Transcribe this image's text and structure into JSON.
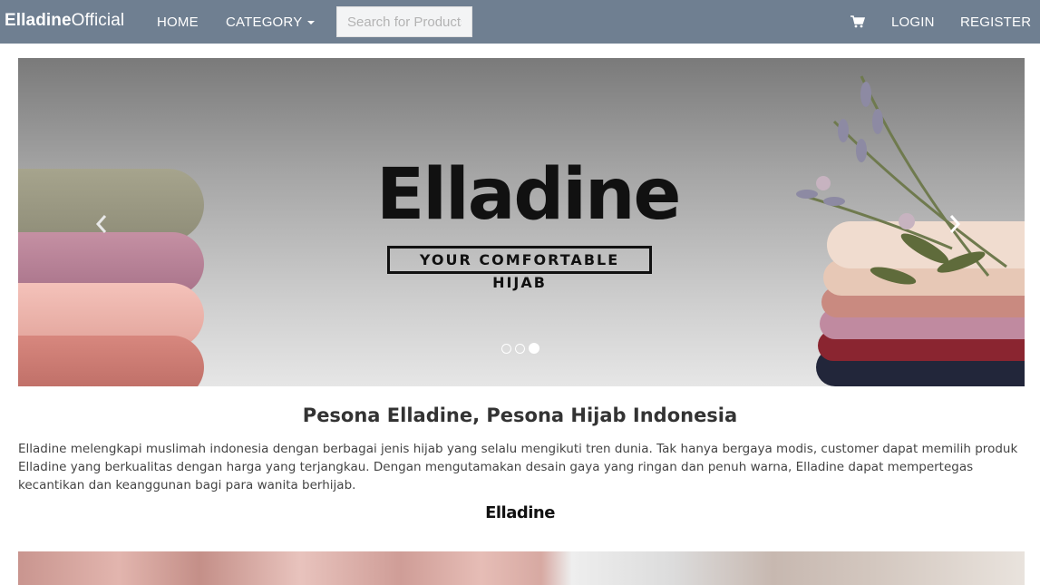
{
  "brand": {
    "bold": "Elladine",
    "regular": "Official"
  },
  "nav": {
    "home": "HOME",
    "category": "CATEGORY",
    "search_placeholder": "Search for Products",
    "cart_icon": "shopping-cart-icon",
    "login": "LOGIN",
    "register": "REGISTER"
  },
  "carousel": {
    "logo_word": "Elladine",
    "tagline": "YOUR COMFORTABLE HIJAB",
    "slide_count": 3,
    "active_slide": 3
  },
  "content": {
    "heading": "Pesona Elladine, Pesona Hijab Indonesia",
    "description": "Elladine melengkapi muslimah indonesia dengan berbagai jenis hijab yang selalu mengikuti tren dunia. Tak hanya bergaya modis, customer dapat memilih produk Elladine yang berkualitas dengan harga yang terjangkau. Dengan mengutamakan desain gaya yang ringan dan penuh warna, Elladine dapat mempertegas kecantikan dan keanggunan bagi para wanita berhijab.",
    "signature": "Elladine"
  },
  "colors": {
    "navbar": "#6f7f91",
    "text": "#333333"
  }
}
